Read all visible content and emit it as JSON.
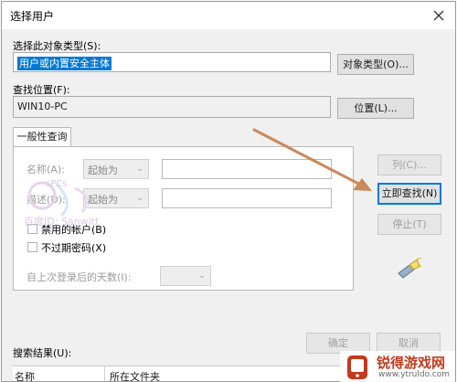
{
  "window": {
    "title": "选择用户"
  },
  "object_type": {
    "label": "选择此对象类型(S):",
    "value": "用户或内置安全主体",
    "button": "对象类型(O)..."
  },
  "location": {
    "label": "查找位置(F):",
    "value": "WIN10-PC",
    "button": "位置(L)..."
  },
  "query_tab": {
    "label": "一般性查询",
    "name_label": "名称(A):",
    "name_op": "起始为",
    "desc_label": "描述(D):",
    "desc_op": "起始为",
    "disabled_accounts": "禁用的帐户(B)",
    "no_expire_password": "不过期密码(X)",
    "days_since_logon": "自上次登录后的天数(I):"
  },
  "buttons": {
    "columns": "列(C)...",
    "find_now": "立即查找(N)",
    "stop": "停止(T)",
    "ok": "确定",
    "cancel": "取消"
  },
  "results": {
    "label": "搜索结果(U):",
    "col_name": "名称",
    "col_folder": "所在文件夹"
  },
  "watermark": {
    "line1": "百度ID: Sanwitt",
    "line2": "sPCs"
  },
  "logo": {
    "name": "锐得游戏网",
    "url": "www.ytruldo.com"
  },
  "colors": {
    "accent": "#0078d7",
    "selection": "#0078d7",
    "arrow": "#c9895a",
    "logo_red": "#c23a1d"
  },
  "icons": [
    "close-icon",
    "search-flashlight-icon",
    "arrow-annotation",
    "phone-logo-icon",
    "dropdown-chevron-icon",
    "checkbox-icon"
  ]
}
